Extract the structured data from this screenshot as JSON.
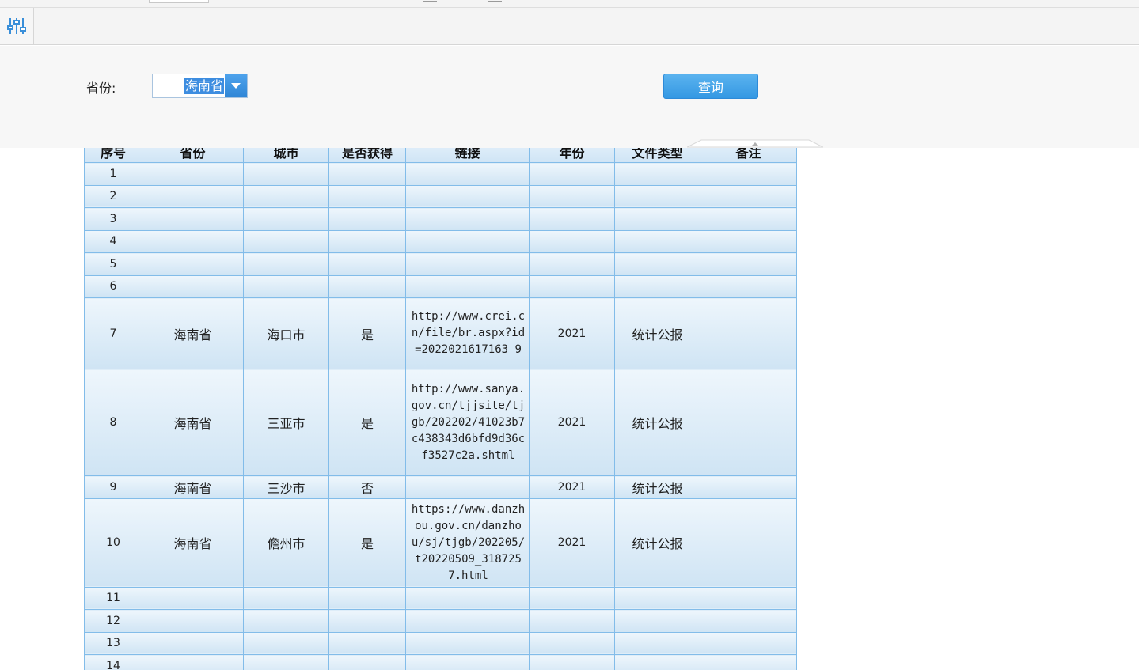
{
  "params": {
    "province_label": "省份:",
    "province_value": "海南省",
    "query_label": "查询"
  },
  "table": {
    "headers": [
      "序号",
      "省份",
      "城市",
      "是否获得",
      "链接",
      "年份",
      "文件类型",
      "备注"
    ],
    "rows": [
      {
        "seq": "1",
        "province": "",
        "city": "",
        "obtained": "",
        "link": "",
        "year": "",
        "type": "",
        "note": ""
      },
      {
        "seq": "2",
        "province": "",
        "city": "",
        "obtained": "",
        "link": "",
        "year": "",
        "type": "",
        "note": ""
      },
      {
        "seq": "3",
        "province": "",
        "city": "",
        "obtained": "",
        "link": "",
        "year": "",
        "type": "",
        "note": ""
      },
      {
        "seq": "4",
        "province": "",
        "city": "",
        "obtained": "",
        "link": "",
        "year": "",
        "type": "",
        "note": ""
      },
      {
        "seq": "5",
        "province": "",
        "city": "",
        "obtained": "",
        "link": "",
        "year": "",
        "type": "",
        "note": ""
      },
      {
        "seq": "6",
        "province": "",
        "city": "",
        "obtained": "",
        "link": "",
        "year": "",
        "type": "",
        "note": ""
      },
      {
        "seq": "7",
        "province": "海南省",
        "city": "海口市",
        "obtained": "是",
        "link": "http://www.crei.cn/file/br.aspx?id=2022021617163 9",
        "year": "2021",
        "type": "统计公报",
        "note": ""
      },
      {
        "seq": "8",
        "province": "海南省",
        "city": "三亚市",
        "obtained": "是",
        "link": "http://www.sanya.gov.cn/tjjsite/tjgb/202202/41023b7c438343d6bfd9d36cf3527c2a.shtml",
        "year": "2021",
        "type": "统计公报",
        "note": ""
      },
      {
        "seq": "9",
        "province": "海南省",
        "city": "三沙市",
        "obtained": "否",
        "link": "",
        "year": "2021",
        "type": "统计公报",
        "note": ""
      },
      {
        "seq": "10",
        "province": "海南省",
        "city": "儋州市",
        "obtained": "是",
        "link": "https://www.danzhou.gov.cn/danzhou/sj/tjgb/202205/t20220509_3187257.html",
        "year": "2021",
        "type": "统计公报",
        "note": ""
      },
      {
        "seq": "11",
        "province": "",
        "city": "",
        "obtained": "",
        "link": "",
        "year": "",
        "type": "",
        "note": ""
      },
      {
        "seq": "12",
        "province": "",
        "city": "",
        "obtained": "",
        "link": "",
        "year": "",
        "type": "",
        "note": ""
      },
      {
        "seq": "13",
        "province": "",
        "city": "",
        "obtained": "",
        "link": "",
        "year": "",
        "type": "",
        "note": ""
      },
      {
        "seq": "14",
        "province": "",
        "city": "",
        "obtained": "",
        "link": "",
        "year": "",
        "type": "",
        "note": ""
      }
    ]
  }
}
